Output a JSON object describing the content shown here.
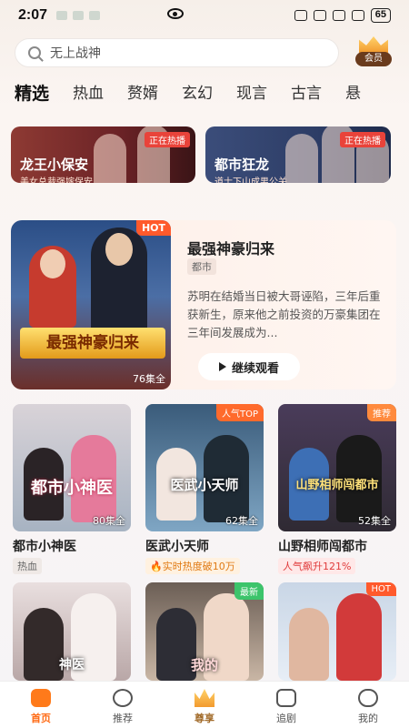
{
  "status_bar": {
    "time": "2:07",
    "battery": "65"
  },
  "search": {
    "placeholder": "无上战神"
  },
  "vip": {
    "label": "会员"
  },
  "tabs": [
    "精选",
    "热血",
    "赘婿",
    "玄幻",
    "现言",
    "古言",
    "悬"
  ],
  "live_cards": [
    {
      "title": "龙王小保安",
      "subtitle": "美女总裁强嫁保安",
      "badge": "正在热播"
    },
    {
      "title": "都市狂龙",
      "subtitle": "道士下山成男公关",
      "badge": "正在热播"
    }
  ],
  "featured": {
    "title": "最强神豪归来",
    "tag": "都市",
    "description": "苏明在结婚当日被大哥诬陷，三年后重获新生，原来他之前投资的万豪集团在三年间发展成为...",
    "cover_text": "最强神豪归来",
    "badge": "HOT",
    "episodes": "76集全",
    "button": "继续观看"
  },
  "grid": [
    {
      "title": "都市小神医",
      "tag": "热血",
      "cover_text": "都市小神医",
      "episodes": "80集全",
      "badge": ""
    },
    {
      "title": "医武小天师",
      "tag": "实时热度破10万",
      "cover_text": "医武小天师",
      "episodes": "62集全",
      "badge": "人气TOP"
    },
    {
      "title": "山野相师闯都市",
      "tag": "人气飙升121%",
      "cover_text": "山野相师闯都市",
      "episodes": "52集全",
      "badge": "推荐"
    },
    {
      "title": "",
      "tag": "",
      "cover_text": "神医",
      "episodes": "",
      "badge": ""
    },
    {
      "title": "",
      "tag": "",
      "cover_text": "我的",
      "episodes": "",
      "badge": "最新"
    },
    {
      "title": "",
      "tag": "",
      "cover_text": "",
      "episodes": "",
      "badge": "HOT"
    }
  ],
  "bottom_nav": [
    "首页",
    "推荐",
    "尊享",
    "追剧",
    "我的"
  ]
}
